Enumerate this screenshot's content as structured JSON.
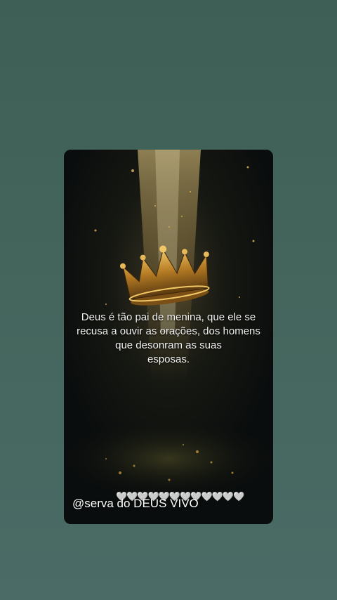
{
  "background": {
    "color": "#436459"
  },
  "image": {
    "subject_icon": "crown-icon",
    "quote_lines": [
      "Deus é tão pai de menina, que ele se",
      "recusa a ouvir as orações, dos homens",
      "que desonram as suas",
      "esposas."
    ],
    "credit": "@serva do DEUS VIVO",
    "hearts": "🤍🤍🤍🤍🤍🤍🤍🤍🤍🤍🤍🤍"
  },
  "colors": {
    "accent_gold": "#d9a441",
    "card_bg": "#0d1111"
  }
}
